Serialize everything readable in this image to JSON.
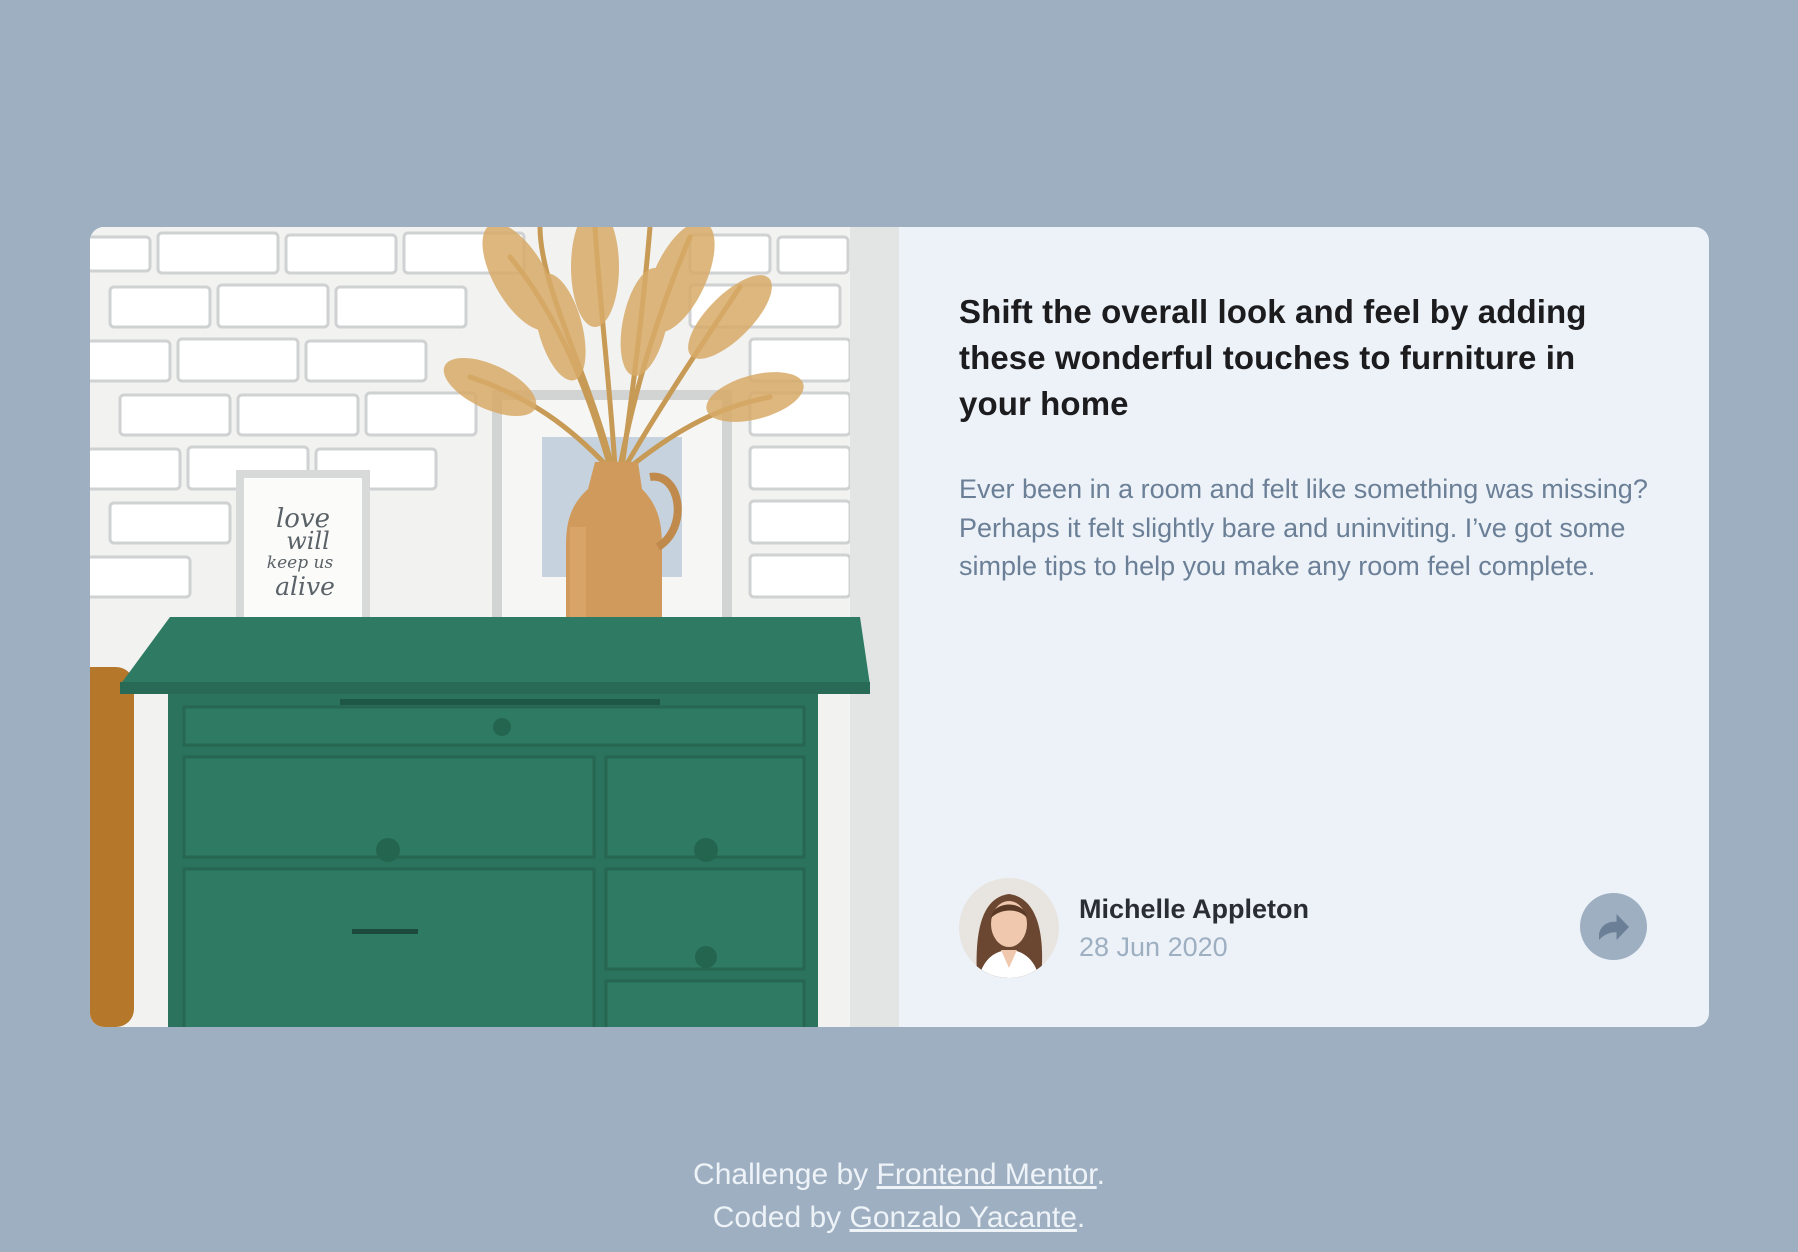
{
  "article": {
    "title": "Shift the overall look and feel by adding these wonderful touches to furniture in your home",
    "description": "Ever been in a room and felt like something was missing? Perhaps it felt slightly bare and uninviting. I’ve got some simple tips to help you make any room feel complete.",
    "image_alt": "Green drawer",
    "frame_text": [
      "love",
      "will",
      "keep us",
      "alive"
    ]
  },
  "author": {
    "name": "Michelle Appleton",
    "date": "28 Jun 2020"
  },
  "share": {
    "icon": "share-icon"
  },
  "footer": {
    "challenge_prefix": "Challenge by ",
    "challenge_link": "Frontend Mentor",
    "coded_prefix": "Coded by ",
    "coded_link": "Gonzalo Yacante",
    "period": "."
  },
  "colors": {
    "background": "#9eafc2",
    "card": "#ecf2f8",
    "title": "#1c1c1f",
    "description": "#6b7f96",
    "muted": "#9eafc2",
    "drawer_green": "#2f7a62"
  }
}
